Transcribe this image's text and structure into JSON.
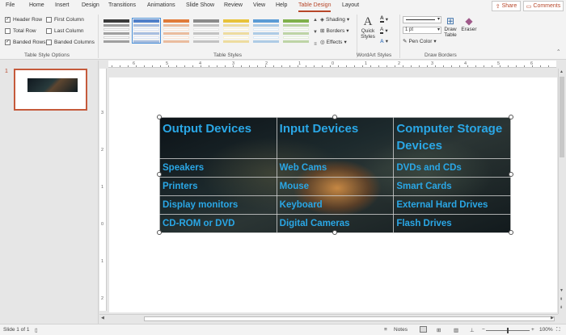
{
  "ribbon_tabs": [
    "File",
    "Home",
    "Insert",
    "Design",
    "Transitions",
    "Animations",
    "Slide Show",
    "Review",
    "View",
    "Help",
    "Table Design",
    "Layout"
  ],
  "active_tab": "Table Design",
  "share_label": "Share",
  "comments_label": "Comments",
  "table_style_options": {
    "items": [
      {
        "label": "Header Row",
        "checked": true
      },
      {
        "label": "First Column",
        "checked": false
      },
      {
        "label": "Total Row",
        "checked": false
      },
      {
        "label": "Last Column",
        "checked": false
      },
      {
        "label": "Banded Rows",
        "checked": true
      },
      {
        "label": "Banded Columns",
        "checked": false
      }
    ],
    "group_label": "Table Style Options"
  },
  "table_styles": {
    "group_label": "Table Styles",
    "thumb_colors": [
      "#3a3a3a",
      "#4f7fc9",
      "#e07b39",
      "#8a8a8a",
      "#e8c23a",
      "#5b9bd5",
      "#7fb04a"
    ]
  },
  "table_tools": {
    "shading_label": "Shading",
    "borders_label": "Borders",
    "effects_label": "Effects",
    "quick_styles_label": "Quick Styles",
    "wordart_label": "WordArt Styles",
    "pen_weight": "1 pt",
    "pen_color_label": "Pen Color",
    "draw_table_label": "Draw Table",
    "eraser_label": "Eraser",
    "draw_borders_label": "Draw Borders"
  },
  "slides_pane": {
    "slide_number": "1"
  },
  "table": {
    "headers": [
      "Output Devices",
      "Input Devices",
      "Computer Storage Devices"
    ],
    "rows": [
      [
        "Speakers",
        "Web Cams",
        "DVDs and CDs"
      ],
      [
        "Printers",
        "Mouse",
        "Smart Cards"
      ],
      [
        "Display monitors",
        "Keyboard",
        "External Hard Drives"
      ],
      [
        "CD-ROM or DVD",
        "Digital Cameras",
        "Flash Drives"
      ]
    ]
  },
  "ruler": {
    "h_labels": [
      "6",
      "5",
      "4",
      "3",
      "2",
      "1",
      "0",
      "1",
      "2",
      "3",
      "4",
      "5",
      "6"
    ],
    "v_labels": [
      "3",
      "2",
      "1",
      "0",
      "1",
      "2",
      "3"
    ]
  },
  "status_bar": {
    "slide_info": "Slide 1 of 1",
    "notes_label": "Notes",
    "zoom": "100%",
    "minus": "−",
    "plus": "+"
  },
  "colors": {
    "accent": "#b7472a",
    "table_text": "#2aa7e6"
  }
}
